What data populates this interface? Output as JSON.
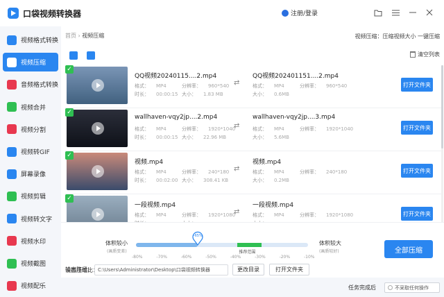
{
  "app": {
    "title": "口袋视频转换器",
    "login": "注册/登录"
  },
  "sidebar": {
    "items": [
      {
        "label": "视频格式转换",
        "color": "#2a86f0"
      },
      {
        "label": "视频压缩",
        "color": "#ffffff",
        "active": true
      },
      {
        "label": "音频格式转换",
        "color": "#e8384f"
      },
      {
        "label": "视频合并",
        "color": "#2fbf52"
      },
      {
        "label": "视频分割",
        "color": "#e8384f"
      },
      {
        "label": "视频转GIF",
        "color": "#2a86f0"
      },
      {
        "label": "屏幕录像",
        "color": "#2a86f0"
      },
      {
        "label": "视频剪辑",
        "color": "#2fbf52"
      },
      {
        "label": "视频转文字",
        "color": "#2a86f0"
      },
      {
        "label": "视频水印",
        "color": "#e8384f"
      },
      {
        "label": "视频截图",
        "color": "#2fbf52"
      },
      {
        "label": "视频配乐",
        "color": "#e8384f"
      }
    ]
  },
  "breadcrumb": {
    "home": "首页",
    "sep": "›",
    "current": "视频压缩"
  },
  "hint": "视频压缩：压缩视频大小 一键压缩",
  "toolbar": {
    "clear": "清空列表"
  },
  "labels": {
    "format": "格式：",
    "resolution": "分辨率：",
    "duration": "时长：",
    "size": "大小：",
    "open_folder": "打开文件夹"
  },
  "files": [
    {
      "src_name": "QQ视频20240115....2.mp4",
      "src_format": "MP4",
      "src_res": "960*540",
      "src_duration": "00:00:15",
      "src_size": "1.83 MB",
      "out_name": "QQ视频2024011​51....2.mp4",
      "out_format": "MP4",
      "out_res": "960*540",
      "out_size": "0.6MB",
      "thumb": [
        "#7a95b6",
        "#41617f"
      ]
    },
    {
      "src_name": "wallhaven-vqy2jp....2.mp4",
      "src_format": "MP4",
      "src_res": "1920*1040",
      "src_duration": "00:00:15",
      "src_size": "22.96 MB",
      "out_name": "wallhaven-vqy2jp....3.mp4",
      "out_format": "MP4",
      "out_res": "1920*1040",
      "out_size": "5.6MB",
      "thumb": [
        "#2b2e3a",
        "#0e1118"
      ]
    },
    {
      "src_name": "视频.mp4",
      "src_format": "MP4",
      "src_res": "240*180",
      "src_duration": "00:02:00",
      "src_size": "308.41 KB",
      "out_name": "视频.mp4",
      "out_format": "MP4",
      "out_res": "240*180",
      "out_size": "0.2MB",
      "thumb": [
        "#c98a7a",
        "#3a4b6b"
      ]
    },
    {
      "src_name": "一段视频.mp4",
      "src_format": "MP4",
      "src_res": "1920*1080",
      "src_duration": "",
      "src_size": "",
      "out_name": "一段视频.mp4",
      "out_format": "MP4",
      "out_res": "1920*1080",
      "out_size": "",
      "thumb": [
        "#9aaebf",
        "#6b7d8e"
      ]
    }
  ],
  "compression": {
    "label": "设置压缩比：",
    "left_title": "体积较小",
    "left_sub": "(画质变差)",
    "right_title": "体积较大",
    "right_sub": "(画质较好)",
    "value_label": "-65%",
    "value": 0.36,
    "recommend": "推荐范围",
    "recommend_range": [
      0.59,
      0.73
    ],
    "ticks": [
      "-80%",
      "-70%",
      "-60%",
      "-50%",
      "-40%",
      "-30%",
      "-20%",
      "-10%"
    ]
  },
  "output": {
    "label": "输出路径：",
    "path": "C:\\Users\\Administrator\\Desktop\\口袋视频转换器",
    "change": "更改目录",
    "open": "打开文件夹"
  },
  "compress_all": "全部压缩",
  "footer": {
    "after_label": "任务完成后",
    "after_option": "不采取任何操作"
  }
}
